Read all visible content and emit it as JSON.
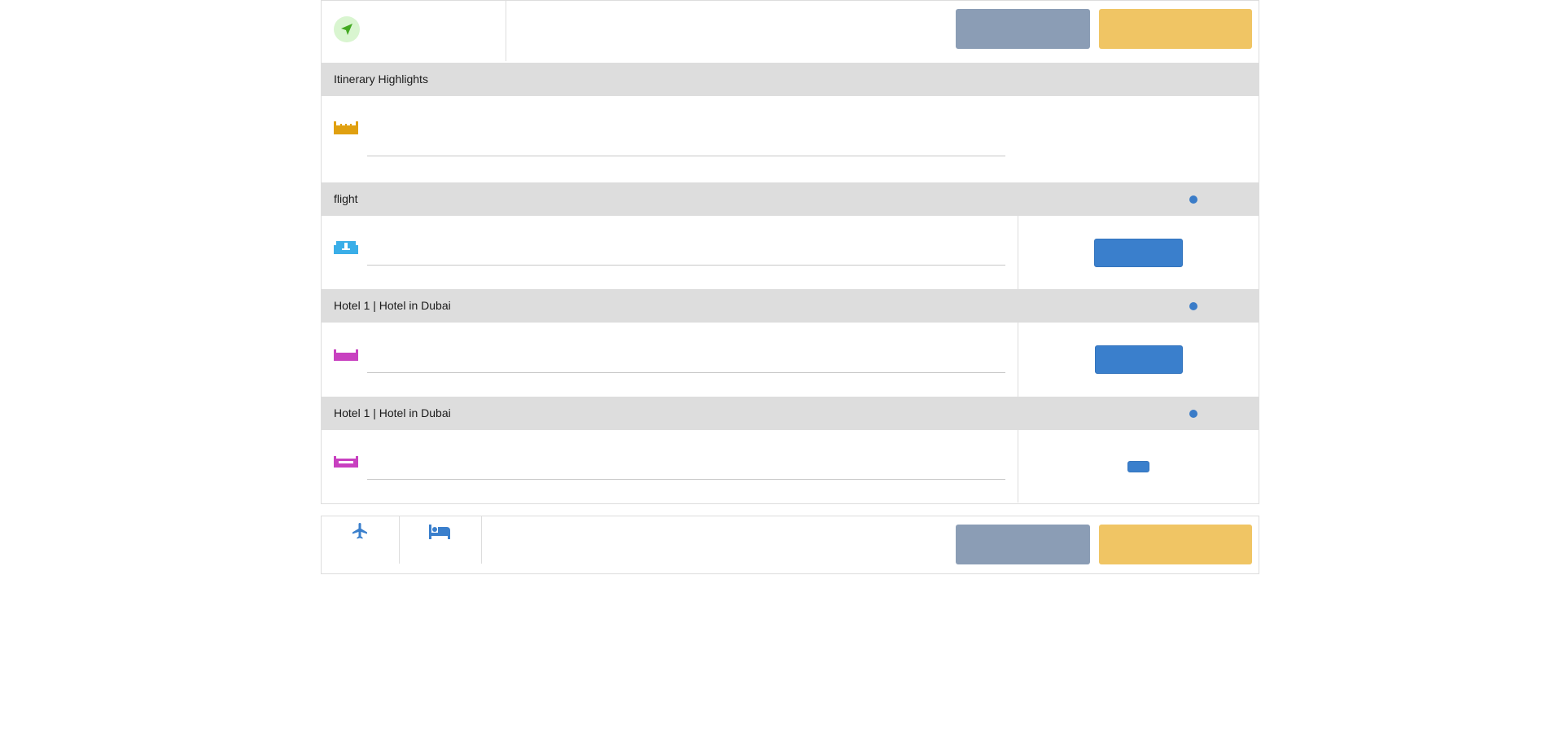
{
  "colors": {
    "accent_blue": "#3a7fcc",
    "grey_button": "#8b9db5",
    "yellow_button": "#f0c564",
    "section_header_bg": "#dddddd",
    "nav_green": "#44aa22",
    "itinerary_icon": "#e0a010",
    "flight_icon": "#3aaee8",
    "hotel_icon": "#c840c0"
  },
  "icons": {
    "top_nav": "location-arrow-icon",
    "itinerary": "itinerary-icon",
    "flight": "flight-ticket-icon",
    "hotel": "hotel-bed-icon",
    "tab_flight": "airplane-icon",
    "tab_hotel": "bed-icon"
  },
  "sections": {
    "highlights": {
      "title": "Itinerary Highlights"
    },
    "flight": {
      "title": "flight"
    },
    "hotel_1": {
      "title": "Hotel 1 | Hotel in Dubai"
    },
    "hotel_2": {
      "title": "Hotel 1 | Hotel in Dubai"
    }
  }
}
